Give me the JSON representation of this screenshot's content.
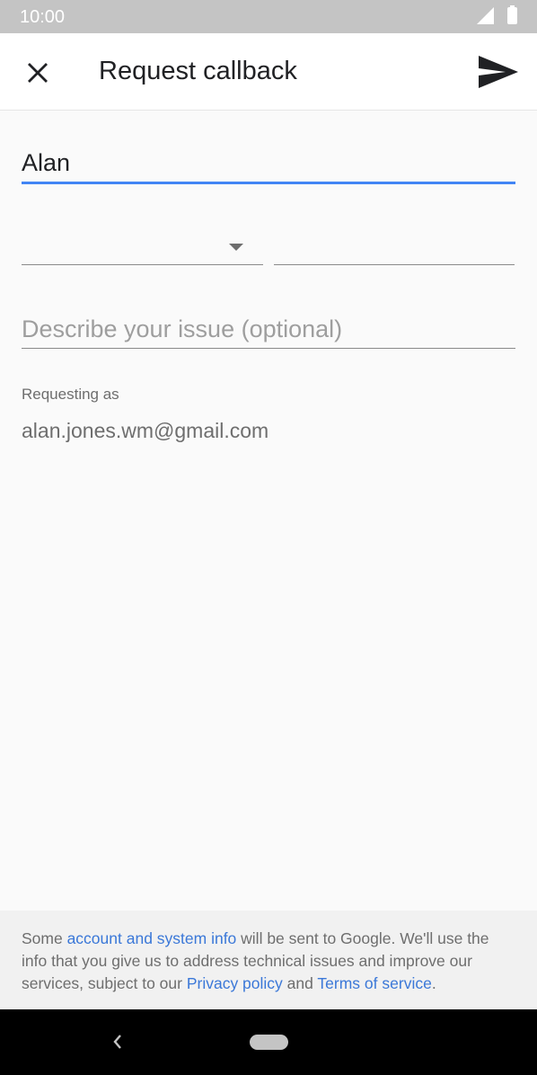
{
  "status_bar": {
    "time": "10:00",
    "icons": [
      "signal-icon",
      "battery-icon"
    ]
  },
  "app_bar": {
    "title": "Request callback",
    "close_icon": "close-icon",
    "send_icon": "send-icon"
  },
  "form": {
    "name_value": "Alan",
    "country_value": "",
    "phone_value": "",
    "issue_placeholder": "Describe your issue (optional)",
    "requesting_label": "Requesting as",
    "email": "alan.jones.wm@gmail.com"
  },
  "footer": {
    "text_1": "Some ",
    "link_account": "account and system info",
    "text_2": " will be sent to Google. We'll use the info that you give us to address technical issues and improve our services, subject to our ",
    "link_privacy": "Privacy policy",
    "text_3": " and ",
    "link_terms": "Terms of service",
    "text_4": "."
  },
  "colors": {
    "accent": "#4285f4",
    "link": "#3b78d8",
    "status_bar": "#c4c4c4",
    "nav_bar": "#000000"
  },
  "nav_bar": {
    "icons": [
      "back-icon",
      "home-pill-icon"
    ]
  }
}
